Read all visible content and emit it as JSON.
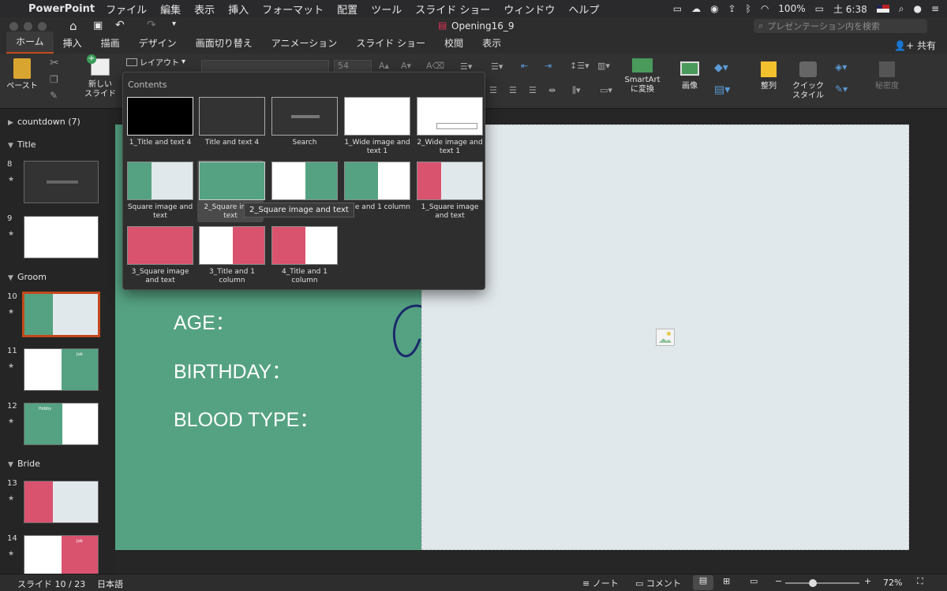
{
  "menubar": {
    "app": "PowerPoint",
    "items": [
      "ファイル",
      "編集",
      "表示",
      "挿入",
      "フォーマット",
      "配置",
      "ツール",
      "スライド ショー",
      "ウィンドウ",
      "ヘルプ"
    ],
    "battery": "100%",
    "clock": "土 6:38"
  },
  "window": {
    "title": "Opening16_9",
    "search_placeholder": "プレゼンテーション内を検索"
  },
  "ribbon_tabs": [
    "ホーム",
    "挿入",
    "描画",
    "デザイン",
    "画面切り替え",
    "アニメーション",
    "スライド ショー",
    "校閲",
    "表示"
  ],
  "share": "共有",
  "ribbon": {
    "paste": "ペースト",
    "new_slide": "新しい\nスライド",
    "layout": "レイアウト",
    "font_size": "54",
    "smartart": "SmartArt\nに変換",
    "image": "画像",
    "arrange": "整列",
    "quick_style": "クイック\nスタイル",
    "sensitivity": "秘密度"
  },
  "dropdown": {
    "title": "Contents",
    "layouts": [
      "1_Title and text 4",
      "Title and text 4",
      "Search",
      "1_Wide image and text 1",
      "2_Wide image and text 1",
      "Square image and text",
      "2_Square image and text",
      "",
      "Title and 1 column",
      "1_Square image and text",
      "3_Square image and text",
      "3_Title and 1 column",
      "4_Title and 1 column"
    ],
    "layout6_partial": "2_Square imag\ntext",
    "layout8_partial": "Title and 1 column",
    "tooltip": "2_Square image and text"
  },
  "panel": {
    "sections": [
      {
        "name": "countdown (7)",
        "collapsed": true
      },
      {
        "name": "Title",
        "collapsed": false
      },
      {
        "name": "Groom",
        "collapsed": false
      },
      {
        "name": "Bride",
        "collapsed": false
      }
    ],
    "slides": [
      "8",
      "9",
      "10",
      "11",
      "12",
      "13",
      "14"
    ],
    "thumb_labels": {
      "s11": "Job",
      "s12": "Hobby",
      "s14": "Job"
    }
  },
  "slide": {
    "fields": [
      "AGE：",
      "BIRTHDAY：",
      "BLOOD TYPE："
    ]
  },
  "status": {
    "slide_info": "スライド 10 / 23",
    "language": "日本語",
    "notes": "ノート",
    "comments": "コメント",
    "zoom": "72%"
  },
  "colors": {
    "accent": "#c4491c",
    "groom_green": "#55a282",
    "bride_pink": "#d9536f",
    "image_placeholder": "#e1e8ec"
  }
}
